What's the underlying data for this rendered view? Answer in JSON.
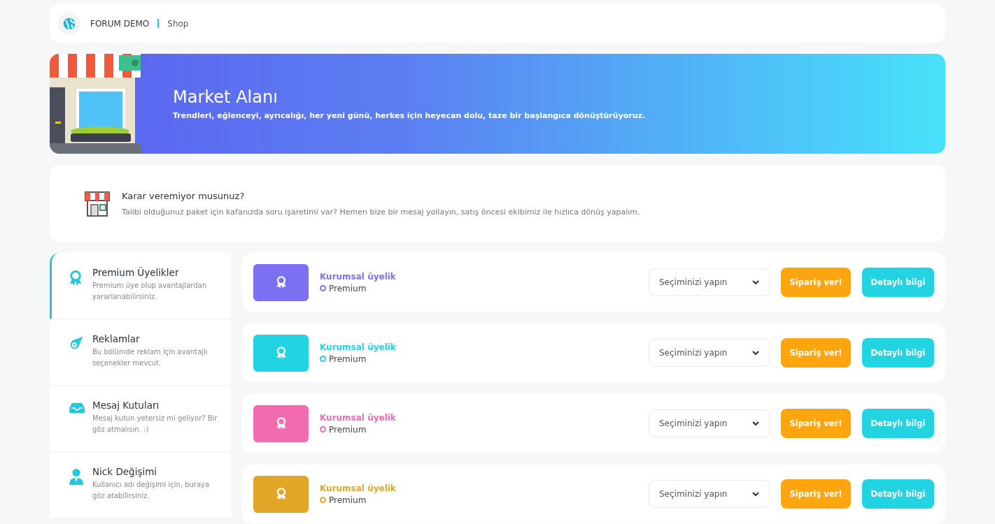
{
  "breadcrumb": {
    "site": "FORUM DEMO",
    "page": "Shop"
  },
  "banner": {
    "title": "Market Alanı",
    "subtitle": "Trendleri, eğlenceyi, ayrıcalığı, her yeni günü, herkes için heyecan dolu, taze bir başlangıca dönüştürüyoruz."
  },
  "notice": {
    "title": "Karar veremiyor musunuz?",
    "text": "Talibi olduğunuz paket için kafanızda soru işaretimi var? Hemen bize bir mesaj yollayın, satış öncesi ekibimiz ile hızlıca dönüş yapalım."
  },
  "sidebar": {
    "items": [
      {
        "kind": "award",
        "title": "Premium Üyelikler",
        "text": "Premium üye olup avantajlardan yararlanabilirsiniz.",
        "selected": true
      },
      {
        "kind": "comet",
        "title": "Reklamlar",
        "text": "Bu bölümde reklam için avantajlı seçenekler mevcut.",
        "selected": false
      },
      {
        "kind": "inbox",
        "title": "Mesaj Kutuları",
        "text": "Mesaj kutun yetersiz mi geliyor? Bir göz atmalısın. :)",
        "selected": false
      },
      {
        "kind": "user",
        "title": "Nick Değişimi",
        "text": "Kullanıcı adı değişimi için, buraya göz atabilirsiniz.",
        "selected": false
      }
    ]
  },
  "products": [
    {
      "name": "Kurumsal üyelik",
      "tier": "Premium",
      "color": "#7b6ff2",
      "select": {
        "placeholder": "Seçiminizi yapın"
      },
      "buttons": [
        "Sipariş ver!",
        "Detaylı bilgi"
      ]
    },
    {
      "name": "Kurumsal üyelik",
      "tier": "Premium",
      "color": "#22d3e2",
      "select": {
        "placeholder": "Seçiminizi yapın"
      },
      "buttons": [
        "Sipariş ver!",
        "Detaylı bilgi"
      ]
    },
    {
      "name": "Kurumsal üyelik",
      "tier": "Premium",
      "color": "#f06bb0",
      "select": {
        "placeholder": "Seçiminizi yapın"
      },
      "buttons": [
        "Sipariş ver!",
        "Detaylı bilgi"
      ]
    },
    {
      "name": "Kurumsal üyelik",
      "tier": "Premium",
      "color": "#e2a626",
      "select": {
        "placeholder": "Seçiminizi yapın"
      },
      "buttons": [
        "Sipariş ver!",
        "Detaylı bilgi"
      ]
    }
  ]
}
